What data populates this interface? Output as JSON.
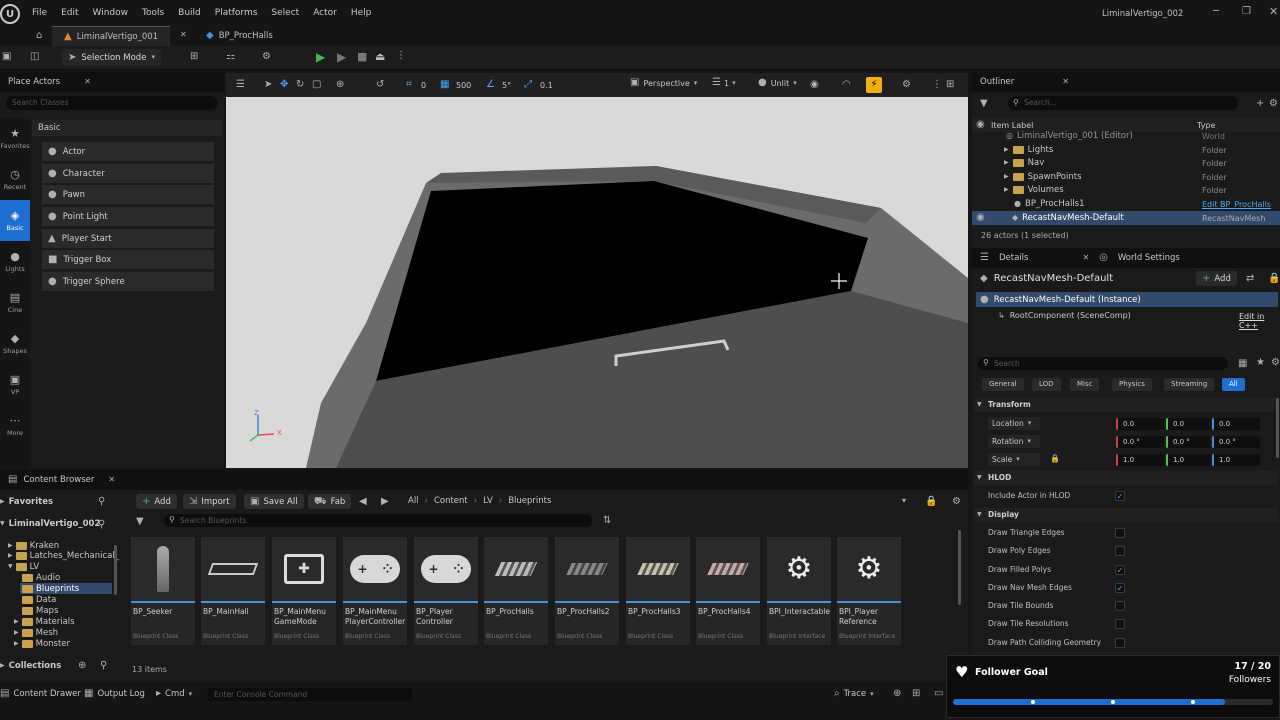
{
  "menu": {
    "items": [
      "File",
      "Edit",
      "Window",
      "Tools",
      "Build",
      "Platforms",
      "Select",
      "Actor",
      "Help"
    ],
    "project_name": "LiminalVertigo_002"
  },
  "tabs": {
    "level": "LiminalVertigo_001",
    "blueprint": "BP_ProcHalls"
  },
  "toolbar": {
    "selection_mode": "Selection Mode"
  },
  "place_actors": {
    "title": "Place Actors",
    "search_placeholder": "Search Classes",
    "category": "Basic",
    "rail": [
      {
        "label": "Favorites",
        "icon": "star-icon"
      },
      {
        "label": "Recent",
        "icon": "clock-icon"
      },
      {
        "label": "Basic",
        "icon": "cube-icon"
      },
      {
        "label": "Lights",
        "icon": "bulb-icon"
      },
      {
        "label": "Cine",
        "icon": "film-icon"
      },
      {
        "label": "Shapes",
        "icon": "shapes-icon"
      },
      {
        "label": "VP",
        "icon": "camera-icon"
      },
      {
        "label": "More",
        "icon": "more-icon"
      }
    ],
    "items": [
      "Actor",
      "Character",
      "Pawn",
      "Point Light",
      "Player Start",
      "Trigger Box",
      "Trigger Sphere"
    ]
  },
  "viewport": {
    "grid_snap": "0",
    "move_snap": "500",
    "rotate_snap": "5°",
    "scale_snap": "0.1",
    "view_mode_perspective": "Perspective",
    "camera_speed": "1",
    "lighting": "Unlit",
    "axis_z": "Z",
    "axis_x": "X"
  },
  "outliner": {
    "title": "Outliner",
    "search_placeholder": "Search...",
    "col_label": "Item Label",
    "col_type": "Type",
    "rows": [
      {
        "label": "LiminalVertigo_001 (Editor)",
        "type": "World"
      },
      {
        "label": "Lights",
        "type": "Folder"
      },
      {
        "label": "Nav",
        "type": "Folder"
      },
      {
        "label": "SpawnPoints",
        "type": "Folder"
      },
      {
        "label": "Volumes",
        "type": "Folder"
      },
      {
        "label": "BP_ProcHalls1",
        "type": "Edit BP_ProcHalls"
      },
      {
        "label": "RecastNavMesh-Default",
        "type": "RecastNavMesh"
      }
    ],
    "count": "26 actors (1 selected)"
  },
  "details": {
    "tab_details": "Details",
    "tab_world_settings": "World Settings",
    "actor_name": "RecastNavMesh-Default",
    "add_label": "Add",
    "instance": "RecastNavMesh-Default (Instance)",
    "root_component": "RootComponent (SceneComp)",
    "edit_cpp": "Edit in C++",
    "search_placeholder": "Search",
    "categories": [
      "General",
      "LOD",
      "Misc",
      "Physics",
      "Streaming",
      "All"
    ],
    "transform": {
      "header": "Transform",
      "location_label": "Location",
      "location": [
        "0.0",
        "0.0",
        "0.0"
      ],
      "rotation_label": "Rotation",
      "rotation": [
        "0.0 °",
        "0.0 °",
        "0.0 °"
      ],
      "scale_label": "Scale",
      "scale": [
        "1.0",
        "1.0",
        "1.0"
      ]
    },
    "hlod": {
      "header": "HLOD",
      "include_label": "Include Actor in HLOD"
    },
    "display": {
      "header": "Display",
      "rows": [
        {
          "label": "Draw Triangle Edges",
          "checked": false
        },
        {
          "label": "Draw Poly Edges",
          "checked": false
        },
        {
          "label": "Draw Filled Polys",
          "checked": true
        },
        {
          "label": "Draw Nav Mesh Edges",
          "checked": true
        },
        {
          "label": "Draw Tile Bounds",
          "checked": false
        },
        {
          "label": "Draw Tile Resolutions",
          "checked": false
        },
        {
          "label": "Draw Path Colliding Geometry",
          "checked": false
        }
      ]
    }
  },
  "content_browser": {
    "title": "Content Browser",
    "add": "Add",
    "import": "Import",
    "save_all": "Save All",
    "fab": "Fab",
    "breadcrumb": [
      "All",
      "Content",
      "LV",
      "Blueprints"
    ],
    "favorites": "Favorites",
    "project": "LiminalVertigo_002",
    "search_placeholder": "Search Blueprints",
    "folders": [
      "Kraken",
      "Latches_Mechanical_",
      "LV",
      "Audio",
      "Blueprints",
      "Data",
      "Maps",
      "Materials",
      "Mesh",
      "Monster"
    ],
    "collections": "Collections",
    "item_count": "13 items",
    "assets": [
      {
        "name": "BP_Seeker",
        "type": "Blueprint Class"
      },
      {
        "name": "BP_MainHall",
        "type": "Blueprint Class"
      },
      {
        "name": "BP_MainMenu GameMode",
        "type": "Blueprint Class"
      },
      {
        "name": "BP_MainMenu PlayerController",
        "type": "Blueprint Class"
      },
      {
        "name": "BP_Player Controller",
        "type": "Blueprint Class"
      },
      {
        "name": "BP_ProcHalls",
        "type": "Blueprint Class"
      },
      {
        "name": "BP_ProcHalls2",
        "type": "Blueprint Class"
      },
      {
        "name": "BP_ProcHalls3",
        "type": "Blueprint Class"
      },
      {
        "name": "BP_ProcHalls4",
        "type": "Blueprint Class"
      },
      {
        "name": "BPI_Interactable",
        "type": "Blueprint Interface"
      },
      {
        "name": "BPI_Player Reference",
        "type": "Blueprint Interface"
      }
    ]
  },
  "statusbar": {
    "content_drawer": "Content Drawer",
    "output_log": "Output Log",
    "cmd": "Cmd",
    "console_placeholder": "Enter Console Command",
    "trace": "Trace"
  },
  "follower_goal": {
    "title": "Follower Goal",
    "count": "17 / 20",
    "unit": "Followers",
    "progress": 0.85,
    "color": "#1f6fd1"
  },
  "colors": {
    "accent": "#1f6fd1",
    "play": "#3fb950",
    "selection_row": "#324a6b"
  }
}
